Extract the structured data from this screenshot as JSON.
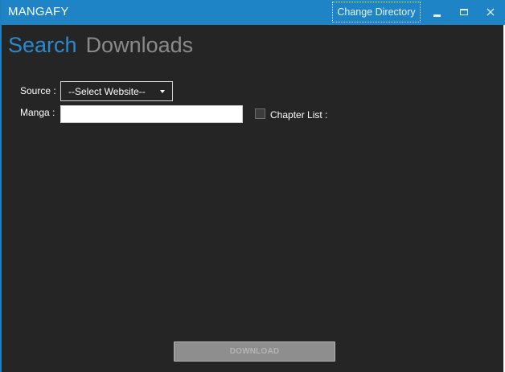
{
  "window": {
    "title": "MANGAFY",
    "change_directory_label": "Change Directory",
    "accent_color": "#1e84c6"
  },
  "tabs": [
    {
      "label": "Search",
      "active": true
    },
    {
      "label": "Downloads",
      "active": false
    }
  ],
  "form": {
    "source_label": "Source :",
    "source_selected": "--Select Website--",
    "manga_label": "Manga :",
    "manga_value": "",
    "chapter_list_label": "Chapter List :",
    "chapter_list_checked": false
  },
  "download_label": "DOWNLOAD",
  "icons": {
    "minimize": "minimize-icon",
    "maximize": "maximize-icon",
    "close": "close-icon",
    "dropdown": "chevron-down-icon"
  }
}
